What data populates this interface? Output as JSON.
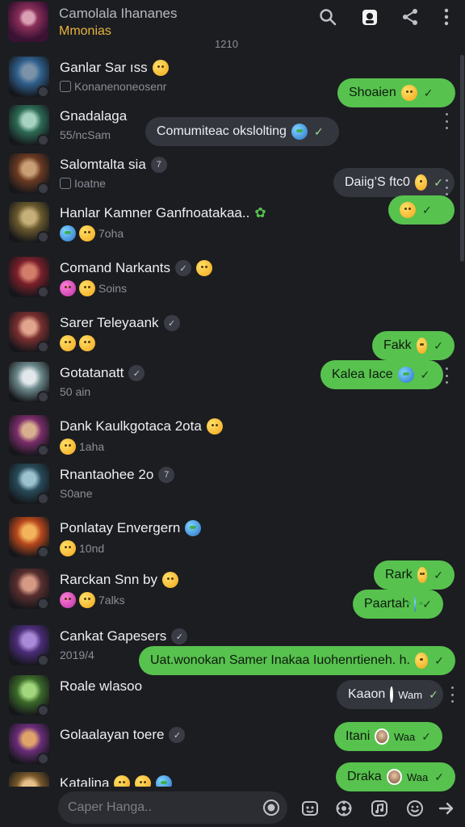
{
  "header": {
    "title": "Camolala Ihananes",
    "subtitle": "Mmonias",
    "counter": "1210"
  },
  "chats": [
    {
      "name": "Ganlar Sar ıss",
      "sub": "Konanenoneosenr",
      "pill": "",
      "colors": [
        "#2f5f8c",
        "#7a93a8"
      ]
    },
    {
      "name": "Gnadalaga",
      "sub": "55/ncSam",
      "pill": "",
      "colors": [
        "#2d6b55",
        "#a7d3c2"
      ]
    },
    {
      "name": "Salomtalta sia",
      "sub": "Ioatne",
      "pill": "7",
      "colors": [
        "#6b3a22",
        "#c9a076"
      ]
    },
    {
      "name": "Hanlar Kamner Ganfnoatakaa..",
      "sub": "7oha",
      "pill": "",
      "colors": [
        "#6a5a2d",
        "#c6b07a"
      ]
    },
    {
      "name": "Comand Narkants",
      "sub": "Soins",
      "pill": "✓",
      "colors": [
        "#7a1f2a",
        "#d27d6a"
      ]
    },
    {
      "name": "Sarer Teleyaank",
      "sub": "",
      "pill": "✓",
      "colors": [
        "#7a2f2f",
        "#e0a58c"
      ]
    },
    {
      "name": "Gotatanatt",
      "sub": "50 ain",
      "pill": "✓",
      "colors": [
        "#6d8a8c",
        "#e1e7ea"
      ]
    },
    {
      "name": "Dank Kaulkgotaca 2ota",
      "sub": "1aha",
      "pill": "",
      "colors": [
        "#7a2d6a",
        "#d9b08f"
      ]
    },
    {
      "name": "Rnantaohee 2o",
      "sub": "S0ane",
      "pill": "7",
      "colors": [
        "#284b5a",
        "#9cc2cf"
      ]
    },
    {
      "name": "Ponlatay Envergern",
      "sub": "10nd",
      "pill": "",
      "colors": [
        "#b8481d",
        "#f2b35b"
      ]
    },
    {
      "name": "Rarckan Snn by",
      "sub": "7alks",
      "pill": "",
      "colors": [
        "#5a2f2f",
        "#d49a86"
      ]
    },
    {
      "name": "Cankat Gapesers",
      "sub": "2019/4",
      "pill": "✓",
      "colors": [
        "#4b2d7a",
        "#a98ad8"
      ]
    },
    {
      "name": "Roale wlasoo",
      "sub": "",
      "pill": "",
      "colors": [
        "#3b6a2a",
        "#a3d77e"
      ]
    },
    {
      "name": "Golaalayan toere",
      "sub": "",
      "pill": "✓",
      "colors": [
        "#6b2d7a",
        "#e0a46a"
      ]
    },
    {
      "name": "Katalina",
      "sub": "",
      "pill": "",
      "colors": [
        "#7a5a2a",
        "#e8c08a"
      ]
    }
  ],
  "bubbles": [
    {
      "text": "Shoaien",
      "type": "out"
    },
    {
      "text": "Comumiteac okslolting",
      "type": "in"
    },
    {
      "text": "Daiig’S ftc0",
      "type": "in"
    },
    {
      "text": "",
      "type": "out"
    },
    {
      "text": "Fakk",
      "type": "out"
    },
    {
      "text": "Kalea Iace",
      "type": "out"
    },
    {
      "text": "Rark",
      "type": "out"
    },
    {
      "text": "Paartah",
      "type": "out"
    },
    {
      "text": "Uat.wonokan Samer Inakaa Iuohenrtieneh. h.",
      "type": "out"
    },
    {
      "text": "Kaaon",
      "type": "in",
      "extra": "Wam"
    },
    {
      "text": "Itani",
      "type": "out",
      "extra": "Waa"
    },
    {
      "text": "Draka",
      "type": "out",
      "extra": "Waa"
    }
  ],
  "composer": {
    "placeholder": "Caper Hanga.."
  },
  "colors": {
    "bg": "#1c1d21",
    "out_bubble": "#57c24e",
    "in_bubble": "#34363e",
    "accent": "#e6b33c"
  }
}
